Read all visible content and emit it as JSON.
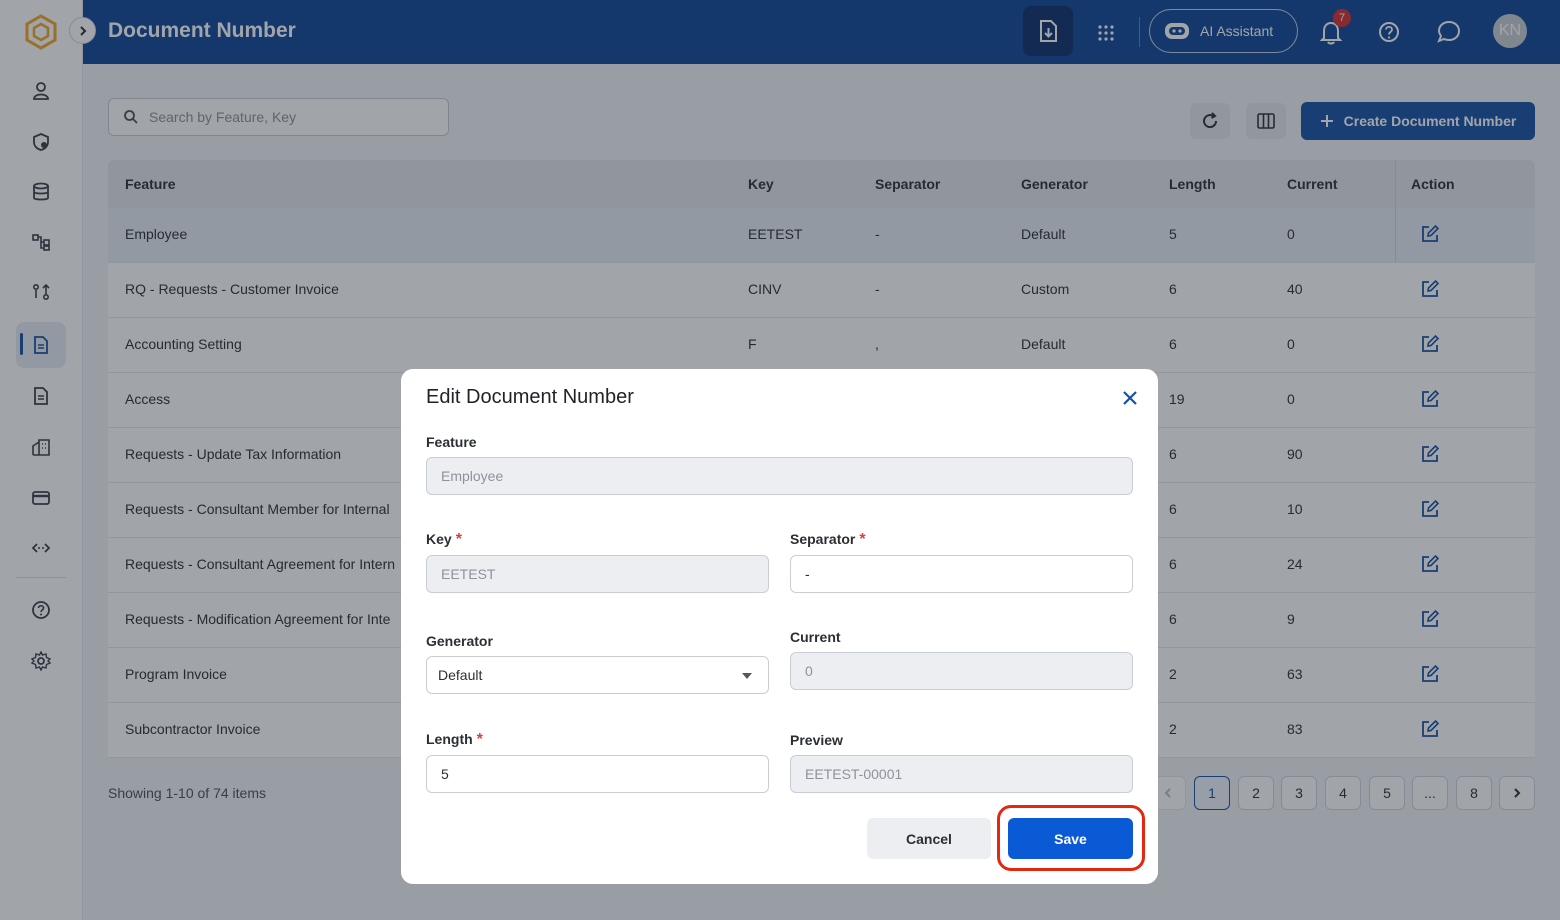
{
  "header": {
    "title": "Document Number",
    "ai_label": "AI Assistant",
    "notification_count": "7",
    "avatar_initials": "KN"
  },
  "toolbar": {
    "search_placeholder": "Search by Feature, Key",
    "create_label": "Create Document Number"
  },
  "table": {
    "columns": {
      "feature": "Feature",
      "key": "Key",
      "separator": "Separator",
      "generator": "Generator",
      "length": "Length",
      "current": "Current",
      "action": "Action"
    },
    "rows": [
      {
        "feature": "Employee",
        "key": "EETEST",
        "separator": "-",
        "generator": "Default",
        "length": "5",
        "current": "0"
      },
      {
        "feature": "RQ - Requests - Customer Invoice",
        "key": "CINV",
        "separator": "-",
        "generator": "Custom",
        "length": "6",
        "current": "40"
      },
      {
        "feature": "Accounting Setting",
        "key": "F",
        "separator": ",",
        "generator": "Default",
        "length": "6",
        "current": "0"
      },
      {
        "feature": "Access",
        "key": "",
        "separator": "",
        "generator": "",
        "length": "19",
        "current": "0"
      },
      {
        "feature": "Requests - Update Tax Information",
        "key": "",
        "separator": "",
        "generator": "",
        "length": "6",
        "current": "90"
      },
      {
        "feature": "Requests - Consultant Member for Internal",
        "key": "",
        "separator": "",
        "generator": "",
        "length": "6",
        "current": "10"
      },
      {
        "feature": "Requests - Consultant Agreement for Intern",
        "key": "",
        "separator": "",
        "generator": "",
        "length": "6",
        "current": "24"
      },
      {
        "feature": "Requests - Modification Agreement for Inte",
        "key": "",
        "separator": "",
        "generator": "",
        "length": "6",
        "current": "9"
      },
      {
        "feature": "Program Invoice",
        "key": "",
        "separator": "",
        "generator": "",
        "length": "2",
        "current": "63"
      },
      {
        "feature": "Subcontractor Invoice",
        "key": "",
        "separator": "",
        "generator": "",
        "length": "2",
        "current": "83"
      }
    ]
  },
  "pagination": {
    "summary": "Showing 1-10 of 74 items",
    "pages": [
      "1",
      "2",
      "3",
      "4",
      "5",
      "...",
      "8"
    ],
    "next": "›"
  },
  "modal": {
    "title": "Edit Document Number",
    "feature_label": "Feature",
    "feature_value": "Employee",
    "key_label": "Key",
    "key_value": "EETEST",
    "separator_label": "Separator",
    "separator_value": "-",
    "generator_label": "Generator",
    "generator_value": "Default",
    "current_label": "Current",
    "current_value": "0",
    "length_label": "Length",
    "length_value": "5",
    "preview_label": "Preview",
    "preview_value": "EETEST-00001",
    "required_mark": "*",
    "cancel_label": "Cancel",
    "save_label": "Save"
  },
  "colors": {
    "primary": "#1450a3",
    "header": "#0f4596",
    "save": "#0a5ad6",
    "highlight_ring": "#e2280f",
    "required": "#e23b3b"
  }
}
